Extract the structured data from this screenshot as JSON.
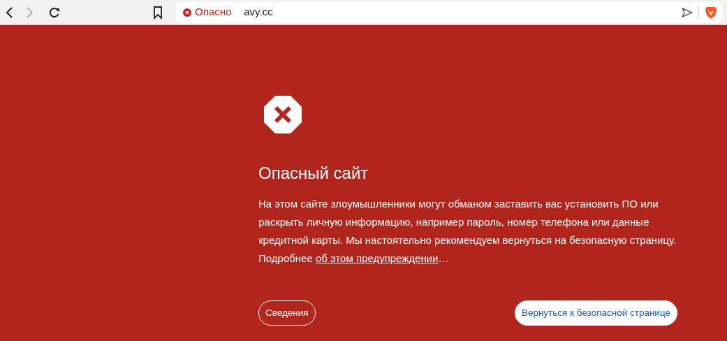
{
  "toolbar": {
    "security_label": "Опасно",
    "url": "avy.cc"
  },
  "interstitial": {
    "title": "Опасный сайт",
    "message": "На этом сайте злоумышленники могут обманом заставить вас установить ПО или раскрыть личную информацию, например пароль, номер телефона или данные кредитной карты. Мы настоятельно рекомендуем вернуться на безопасную страницу. Подробнее ",
    "link": "об этом предупреждении",
    "message_end": "…",
    "buttons": [
      {
        "label": "Сведения",
        "kind": "outline"
      },
      {
        "label": "Вернуться к безопасной странице",
        "kind": "primary"
      }
    ]
  }
}
